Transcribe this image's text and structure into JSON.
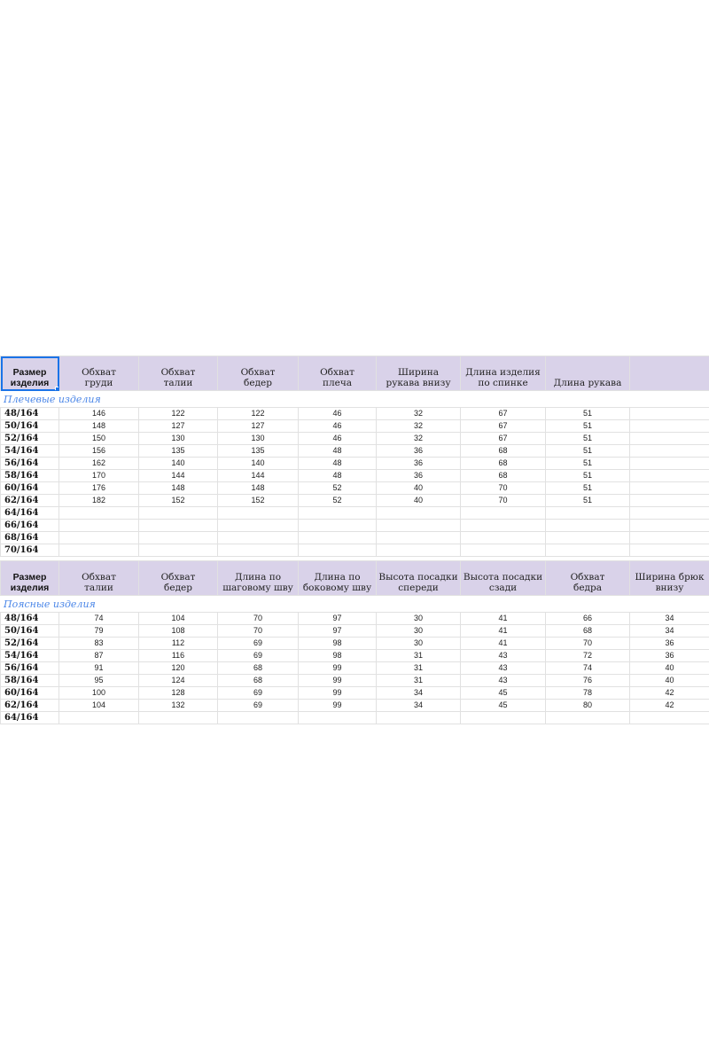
{
  "shoulder": {
    "headers": [
      "Размер\nизделия",
      "Обхват\nгруди",
      "Обхват\nталии",
      "Обхват\nбедер",
      "Обхват\nплеча",
      "Ширина\nрукава внизу",
      "Длина изделия\nпо спинке",
      "Длина рукава",
      ""
    ],
    "section_title": "Плечевые изделия",
    "rows": [
      [
        "48/164",
        "146",
        "122",
        "122",
        "46",
        "32",
        "67",
        "51",
        ""
      ],
      [
        "50/164",
        "148",
        "127",
        "127",
        "46",
        "32",
        "67",
        "51",
        ""
      ],
      [
        "52/164",
        "150",
        "130",
        "130",
        "46",
        "32",
        "67",
        "51",
        ""
      ],
      [
        "54/164",
        "156",
        "135",
        "135",
        "48",
        "36",
        "68",
        "51",
        ""
      ],
      [
        "56/164",
        "162",
        "140",
        "140",
        "48",
        "36",
        "68",
        "51",
        ""
      ],
      [
        "58/164",
        "170",
        "144",
        "144",
        "48",
        "36",
        "68",
        "51",
        ""
      ],
      [
        "60/164",
        "176",
        "148",
        "148",
        "52",
        "40",
        "70",
        "51",
        ""
      ],
      [
        "62/164",
        "182",
        "152",
        "152",
        "52",
        "40",
        "70",
        "51",
        ""
      ],
      [
        "64/164",
        "",
        "",
        "",
        "",
        "",
        "",
        "",
        ""
      ],
      [
        "66/164",
        "",
        "",
        "",
        "",
        "",
        "",
        "",
        ""
      ],
      [
        "68/164",
        "",
        "",
        "",
        "",
        "",
        "",
        "",
        ""
      ],
      [
        "70/164",
        "",
        "",
        "",
        "",
        "",
        "",
        "",
        ""
      ]
    ]
  },
  "waist": {
    "headers": [
      "Размер\nизделия",
      "Обхват\nталии",
      "Обхват\nбедер",
      "Длина по\nшаговому шву",
      "Длина по\nбоковому шву",
      "Высота посадки\nспереди",
      "Высота посадки\nсзади",
      "Обхват\nбедра",
      "Ширина брюк\nвнизу"
    ],
    "section_title": "Поясные изделия",
    "rows": [
      [
        "48/164",
        "74",
        "104",
        "70",
        "97",
        "30",
        "41",
        "66",
        "34"
      ],
      [
        "50/164",
        "79",
        "108",
        "70",
        "97",
        "30",
        "41",
        "68",
        "34"
      ],
      [
        "52/164",
        "83",
        "112",
        "69",
        "98",
        "30",
        "41",
        "70",
        "36"
      ],
      [
        "54/164",
        "87",
        "116",
        "69",
        "98",
        "31",
        "43",
        "72",
        "36"
      ],
      [
        "56/164",
        "91",
        "120",
        "68",
        "99",
        "31",
        "43",
        "74",
        "40"
      ],
      [
        "58/164",
        "95",
        "124",
        "68",
        "99",
        "31",
        "43",
        "76",
        "40"
      ],
      [
        "60/164",
        "100",
        "128",
        "69",
        "99",
        "34",
        "45",
        "78",
        "42"
      ],
      [
        "62/164",
        "104",
        "132",
        "69",
        "99",
        "34",
        "45",
        "80",
        "42"
      ],
      [
        "64/164",
        "",
        "",
        "",
        "",
        "",
        "",
        "",
        ""
      ]
    ]
  }
}
